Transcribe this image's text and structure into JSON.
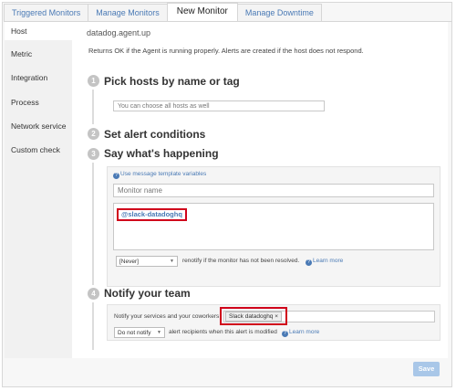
{
  "tabs": [
    {
      "label": "Triggered Monitors"
    },
    {
      "label": "Manage Monitors"
    },
    {
      "label": "New Monitor"
    },
    {
      "label": "Manage Downtime"
    }
  ],
  "sidebar": {
    "items": [
      {
        "label": "Host"
      },
      {
        "label": "Metric"
      },
      {
        "label": "Integration"
      },
      {
        "label": "Process"
      },
      {
        "label": "Network service"
      },
      {
        "label": "Custom check"
      }
    ]
  },
  "check": {
    "value": "datadog.agent.up",
    "description": "Returns OK if the Agent is running properly. Alerts are created if the host does not respond."
  },
  "steps": [
    {
      "num": "1",
      "title": "Pick hosts by name or tag"
    },
    {
      "num": "2",
      "title": "Set alert conditions"
    },
    {
      "num": "3",
      "title": "Say what's happening"
    },
    {
      "num": "4",
      "title": "Notify your team"
    }
  ],
  "hosts": {
    "placeholder": "You can choose all hosts as well"
  },
  "message": {
    "template_link": "Use message template variables",
    "name_placeholder": "Monitor name",
    "body_mention": "@slack-datadoghq"
  },
  "renotify": {
    "selected": "[Never]",
    "text": "renotify if the monitor has not been resolved.",
    "learn_more": "Learn more"
  },
  "notify": {
    "label": "Notify your services and your coworkers",
    "chip": "Slack datadoghq",
    "chip_close": "×",
    "modify_selected": "Do not notify",
    "modify_text": "alert recipients when this alert is modified",
    "learn_more": "Learn more"
  },
  "save_label": "Save",
  "colors": {
    "accent": "#4a7ab5",
    "highlight": "#d0021b",
    "save": "#a9c7e8"
  }
}
